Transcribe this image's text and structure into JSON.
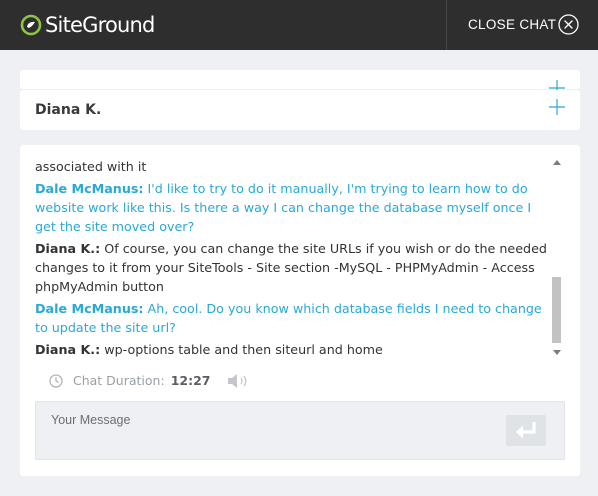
{
  "header": {
    "logo_text": "SiteGround",
    "close_label": "CLOSE CHAT",
    "close_icon": "close-circle-icon"
  },
  "agent": {
    "name": "Diana K."
  },
  "transcript": {
    "leading_text": "associated with it",
    "messages": [
      {
        "author": "Dale McManus:",
        "role": "customer",
        "text": " I'd like to try to do it manually, I'm trying to learn how to do website work like this. Is there a way I can change the database myself once I get the site moved over?"
      },
      {
        "author": "Diana K.:",
        "role": "agent",
        "text": " Of course, you can change the site URLs if you wish or do the needed changes to it from your SiteTools - Site section -MySQL - PHPMyAdmin - Access phpMyAdmin button"
      },
      {
        "author": "Dale McManus:",
        "role": "customer",
        "text": " Ah, cool. Do you know which database fields I need to change to update the site url?"
      },
      {
        "author": "Diana K.:",
        "role": "agent",
        "text": " wp-options table and then siteurl and home"
      }
    ]
  },
  "status": {
    "duration_label": "Chat Duration:",
    "duration_value": "12:27"
  },
  "composer": {
    "placeholder": "Your Message",
    "send_icon": "enter-return-icon"
  },
  "colors": {
    "topbar": "#2e2e2e",
    "accent": "#2aa8d8",
    "page_bg": "#eef0f3"
  }
}
